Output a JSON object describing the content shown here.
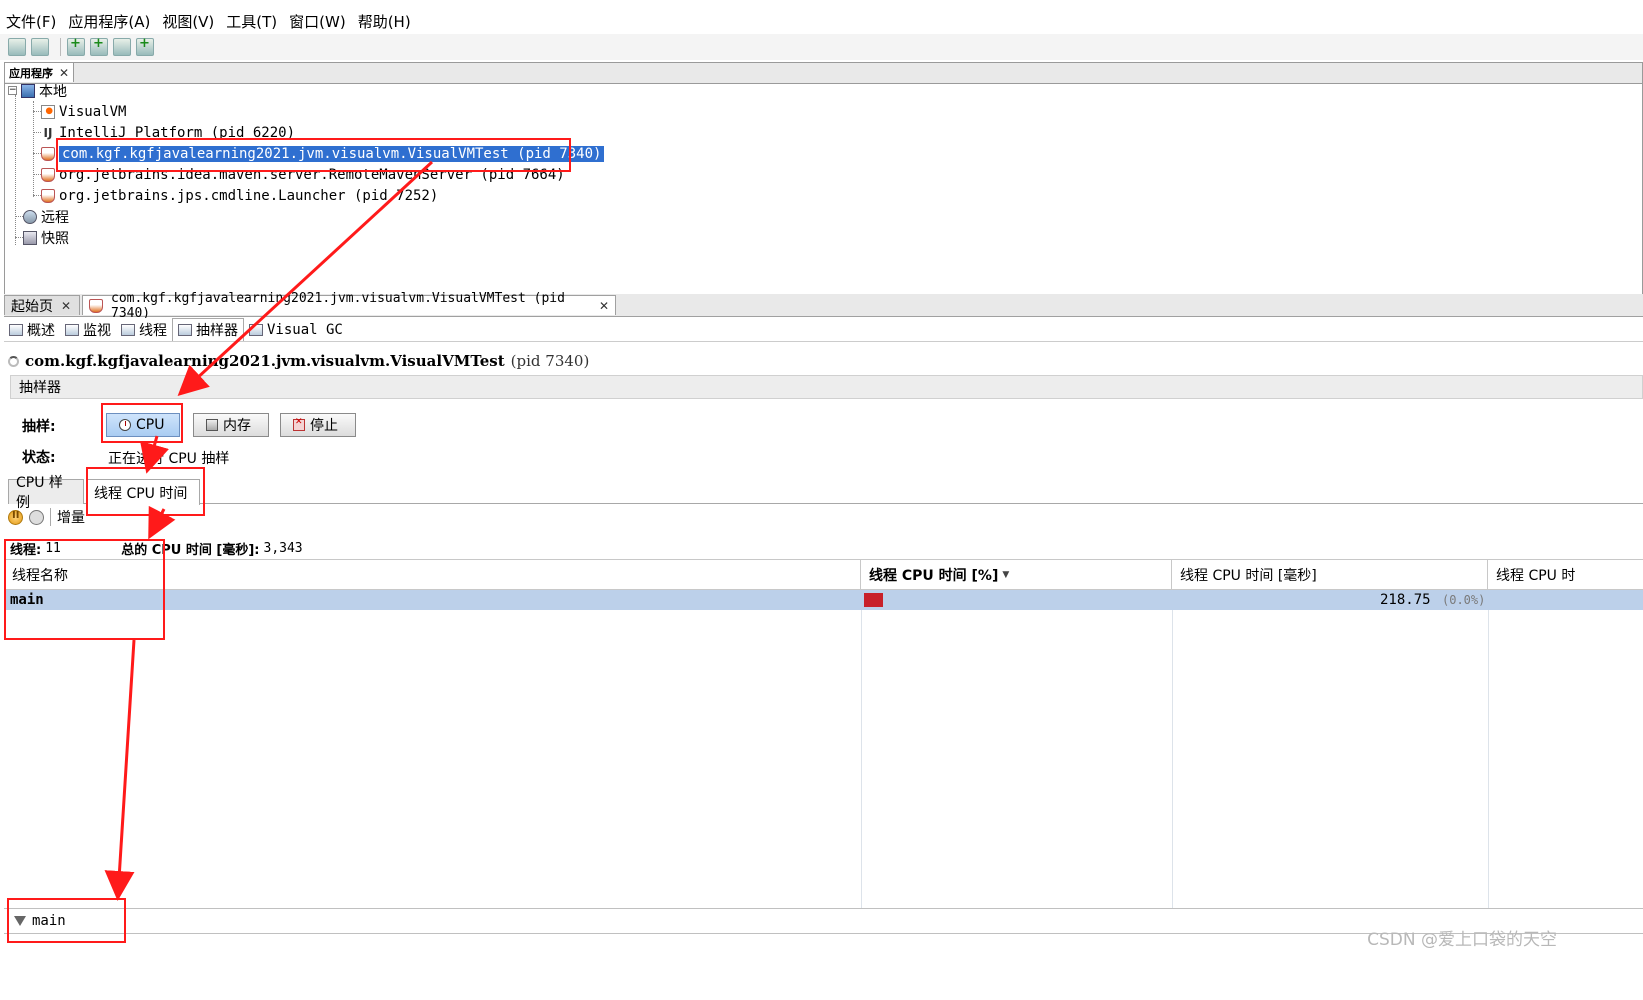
{
  "menu": [
    "文件(F)",
    "应用程序(A)",
    "视图(V)",
    "工具(T)",
    "窗口(W)",
    "帮助(H)"
  ],
  "toolbar": {
    "icons": [
      "open-application-icon",
      "save-snapshot-icon",
      "add-jmx-connection-icon",
      "add-remote-host-icon",
      "add-core-dump-icon",
      "add-snapshot-icon"
    ]
  },
  "apps_panel": {
    "tab_label": "应用程序",
    "local": "本地",
    "items": [
      "VisualVM",
      "IntelliJ Platform (pid 6220)",
      "com.kgf.kgfjavalearning2021.jvm.visualvm.VisualVMTest (pid 7340)",
      "org.jetbrains.idea.maven.server.RemoteMavenServer (pid 7664)",
      "org.jetbrains.jps.cmdline.Launcher (pid 7252)"
    ],
    "remote": "远程",
    "snapshots": "快照"
  },
  "doc_tabs": [
    "起始页",
    "com.kgf.kgfjavalearning2021.jvm.visualvm.VisualVMTest (pid 7340)"
  ],
  "sub_tabs": [
    "概述",
    "监视",
    "线程",
    "抽样器",
    "Visual GC"
  ],
  "app_title": {
    "name": "com.kgf.kgfjavalearning2021.jvm.visualvm.VisualVMTest",
    "pid": "(pid 7340)"
  },
  "sampler": {
    "header": "抽样器",
    "sample_label": "抽样:",
    "status_label": "状态:",
    "buttons": [
      "CPU",
      "内存",
      "停止"
    ],
    "status_value": "正在进行 CPU 抽样"
  },
  "view_tabs": [
    "CPU 样例",
    "线程 CPU 时间"
  ],
  "controls": {
    "delta": "增量"
  },
  "summary": {
    "threads_label": "线程:",
    "threads_value": "11",
    "total_label": "总的 CPU 时间 [毫秒]:",
    "total_value": "3,343"
  },
  "table": {
    "headers": [
      "线程名称",
      "线程 CPU 时间 [%]",
      "线程 CPU 时间 [毫秒]",
      "线程 CPU 时"
    ],
    "rows": [
      {
        "name": "main",
        "percent": 0.0,
        "ms": "218.75",
        "ms_pct": "(0.0%)"
      }
    ]
  },
  "filter": {
    "value": "main"
  },
  "watermark": "CSDN @爱上口袋的天空",
  "colors": {
    "selection": "#2f6fd0",
    "row_highlight": "#bcd0ea",
    "annotation": "#ff1a1a",
    "cpu_bar": "#c8202a"
  }
}
